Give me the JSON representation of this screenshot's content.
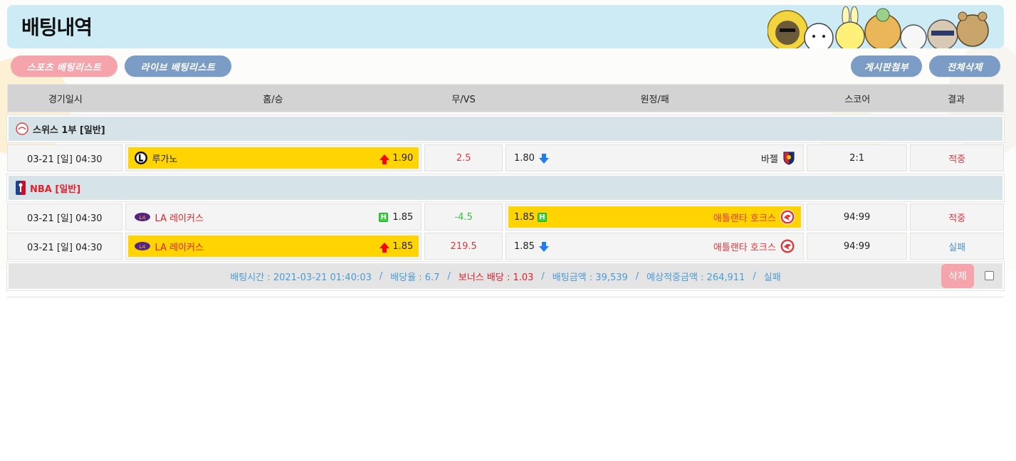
{
  "header": {
    "title": "배팅내역"
  },
  "buttons": {
    "sports": "스포츠 배팅리스트",
    "live": "라이브 배팅리스트",
    "attach": "게시판첨부",
    "delete_all": "전체삭제"
  },
  "columns": [
    "경기일시",
    "홈/승",
    "무/VS",
    "원정/패",
    "스코어",
    "결과"
  ],
  "leagues": [
    {
      "name": "스위스 1부 [일반]",
      "name_color": "#222222",
      "games": [
        {
          "date": "03-21 [일] 04:30",
          "home": "루가노",
          "home_odds": "1.90",
          "home_marker": "arrow-up",
          "draw": "2.5",
          "draw_color": "#e0383e",
          "away": "바젤",
          "away_odds": "1.80",
          "away_marker": "arrow-down",
          "selected": "home",
          "score": "2:1",
          "result": "적중",
          "result_color": "#e0383e"
        }
      ]
    },
    {
      "name": "NBA [일반]",
      "name_color": "#e0202a",
      "games": [
        {
          "date": "03-21 [일] 04:30",
          "home": "LA 레이커스",
          "home_odds": "1.85",
          "home_marker": "H",
          "draw": "-4.5",
          "draw_color": "#34c23e",
          "away": "애틀랜타 호크스",
          "away_odds": "1.85",
          "away_marker": "H",
          "selected": "away",
          "score": "94:99",
          "result": "적중",
          "result_color": "#e0383e"
        },
        {
          "date": "03-21 [일] 04:30",
          "home": "LA 레이커스",
          "home_odds": "1.85",
          "home_marker": "arrow-up",
          "draw": "219.5",
          "draw_color": "#e0383e",
          "away": "애틀랜타 호크스",
          "away_odds": "1.85",
          "away_marker": "arrow-down",
          "selected": "home",
          "score": "94:99",
          "result": "실패",
          "result_color": "#4a92cf"
        }
      ]
    }
  ],
  "summary": {
    "bet_time": "배팅시간 : 2021-03-21 01:40:03",
    "odds": "배당율 : 6.7",
    "bonus": "보너스 배당 : 1.03",
    "amount": "배팅금액 : 39,539",
    "expected": "예상적중금액 : 264,911",
    "status": "실패",
    "delete_label": "삭제",
    "separator": "/"
  },
  "colors": {
    "header_bg": "#cdebf4",
    "pink": "#f4a4aa",
    "blue": "#7b9cc4",
    "selected": "#ffd400",
    "league_bg": "#d6e3e8"
  }
}
